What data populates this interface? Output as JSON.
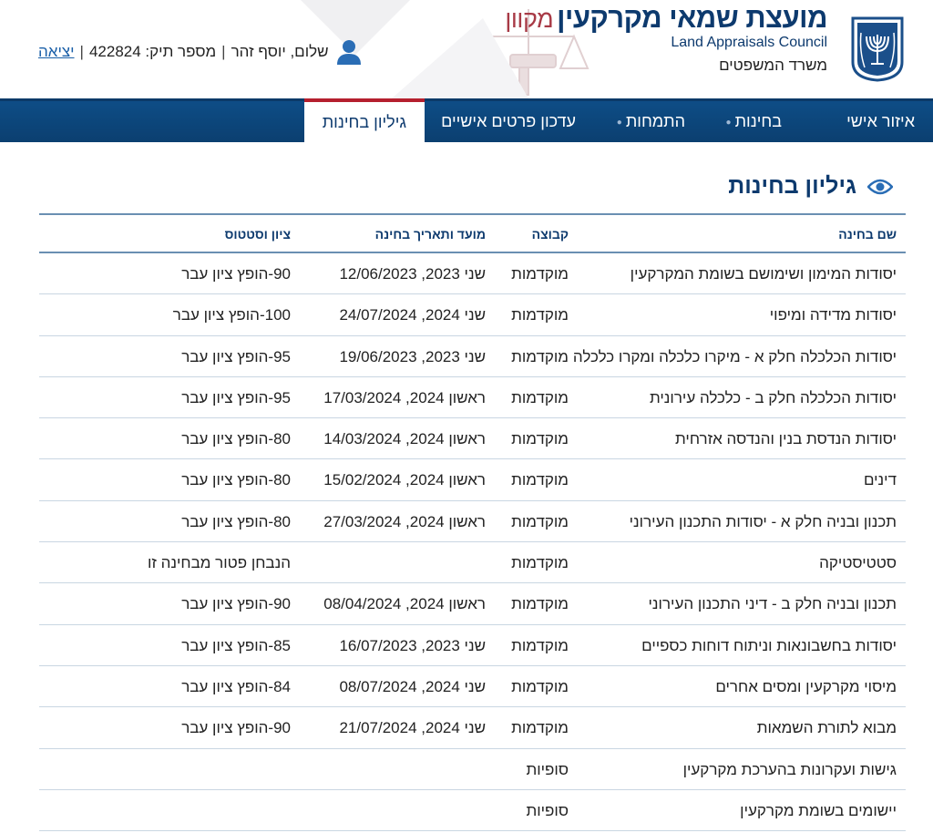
{
  "header": {
    "title": "מועצת שמאי מקרקעין",
    "title_suffix": "מקוון",
    "title_en": "Land Appraisals Council",
    "ministry": "משרד המשפטים",
    "greeting": "שלום, יוסף זהר",
    "file_number_label": "מספר תיק: 422824",
    "separator": "|",
    "logout": "יציאה"
  },
  "nav": {
    "items": [
      {
        "label": "איזור אישי"
      },
      {
        "label": "בחינות"
      },
      {
        "label": "התמחות"
      },
      {
        "label": "עדכון פרטים אישיים"
      },
      {
        "label": "גיליון בחינות"
      }
    ],
    "active": "גיליון בחינות"
  },
  "page": {
    "title": "גיליון בחינות"
  },
  "table": {
    "headers": {
      "name": "שם בחינה",
      "group": "קבוצה",
      "date": "מועד ותאריך בחינה",
      "status": "ציון וסטטוס"
    },
    "rows": [
      {
        "name": "יסודות המימון ושימושם בשומת המקרקעין",
        "group": "מוקדמות",
        "date": "שני 2023, 12/06/2023",
        "status": "90-הופץ ציון עבר"
      },
      {
        "name": "יסודות מדידה ומיפוי",
        "group": "מוקדמות",
        "date": "שני 2024, 24/07/2024",
        "status": "100-הופץ ציון עבר"
      },
      {
        "name": "יסודות הכלכלה חלק א - מיקרו כלכלה ומקרו כלכלה",
        "group": "מוקדמות",
        "date": "שני 2023, 19/06/2023",
        "status": "95-הופץ ציון עבר"
      },
      {
        "name": "יסודות הכלכלה חלק ב - כלכלה עירונית",
        "group": "מוקדמות",
        "date": "ראשון 2024, 17/03/2024",
        "status": "95-הופץ ציון עבר"
      },
      {
        "name": "יסודות הנדסת בנין והנדסה אזרחית",
        "group": "מוקדמות",
        "date": "ראשון 2024, 14/03/2024",
        "status": "80-הופץ ציון עבר"
      },
      {
        "name": "דינים",
        "group": "מוקדמות",
        "date": "ראשון 2024, 15/02/2024",
        "status": "80-הופץ ציון עבר"
      },
      {
        "name": "תכנון ובניה חלק א - יסודות התכנון העירוני",
        "group": "מוקדמות",
        "date": "ראשון 2024, 27/03/2024",
        "status": "80-הופץ ציון עבר"
      },
      {
        "name": "סטטיסטיקה",
        "group": "מוקדמות",
        "date": "",
        "status": "הנבחן פטור מבחינה זו"
      },
      {
        "name": "תכנון ובניה חלק ב - דיני התכנון העירוני",
        "group": "מוקדמות",
        "date": "ראשון 2024, 08/04/2024",
        "status": "90-הופץ ציון עבר"
      },
      {
        "name": "יסודות בחשבונאות וניתוח דוחות כספיים",
        "group": "מוקדמות",
        "date": "שני 2023, 16/07/2023",
        "status": "85-הופץ ציון עבר"
      },
      {
        "name": "מיסוי מקרקעין ומסים אחרים",
        "group": "מוקדמות",
        "date": "שני 2024, 08/07/2024",
        "status": "84-הופץ ציון עבר"
      },
      {
        "name": "מבוא לתורת השמאות",
        "group": "מוקדמות",
        "date": "שני 2024, 21/07/2024",
        "status": "90-הופץ ציון עבר"
      },
      {
        "name": "גישות ועקרונות בהערכת מקרקעין",
        "group": "סופיות",
        "date": "",
        "status": ""
      },
      {
        "name": "יישומים בשומת מקרקעין",
        "group": "סופיות",
        "date": "",
        "status": ""
      }
    ]
  },
  "icons": {
    "emblem": "state-emblem-icon",
    "user": "user-icon",
    "eye": "eye-icon"
  },
  "colors": {
    "brand_blue": "#0d3a6e",
    "nav_blue": "#0e4d86",
    "accent_red": "#b51f2e",
    "online_red": "#a83a46",
    "link_blue": "#1a5fa8"
  }
}
